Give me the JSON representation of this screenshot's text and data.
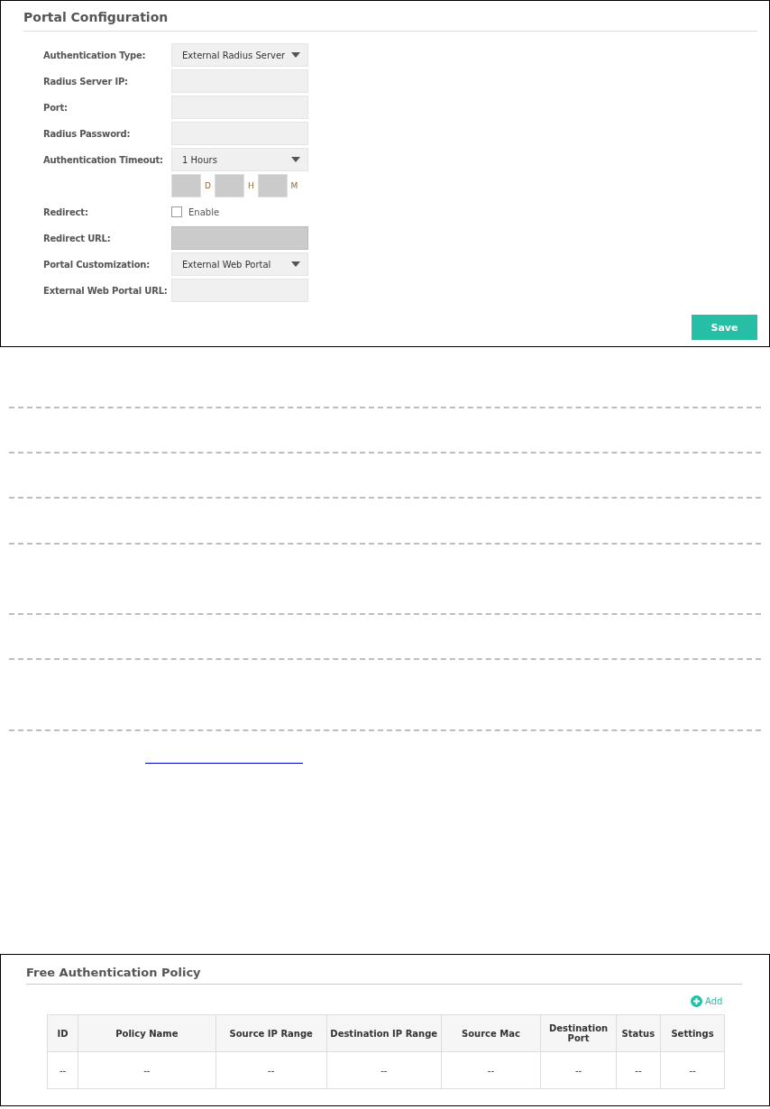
{
  "portal_configuration": {
    "title": "Portal Configuration",
    "fields": [
      {
        "kind": "select",
        "label": "Authentication Type:",
        "value": "External Radius Server"
      },
      {
        "kind": "text",
        "label": "Radius Server IP:",
        "disabled": false
      },
      {
        "kind": "text",
        "label": "Port:",
        "disabled": false
      },
      {
        "kind": "text",
        "label": "Radius Password:",
        "disabled": false
      },
      {
        "kind": "select",
        "label": "Authentication Timeout:",
        "value": "1 Hours"
      },
      {
        "kind": "timer",
        "units": [
          "D",
          "H",
          "M"
        ]
      },
      {
        "kind": "checkbox",
        "label": "Redirect:",
        "option": "Enable",
        "checked": false
      },
      {
        "kind": "text",
        "label": "Redirect URL:",
        "disabled": true
      },
      {
        "kind": "select",
        "label": "Portal Customization:",
        "value": "External Web Portal"
      },
      {
        "kind": "text",
        "label": "External Web Portal URL:",
        "disabled": false
      }
    ],
    "save_button": "Save"
  },
  "free_authentication_policy": {
    "title": "Free Authentication Policy",
    "add_button": "Add",
    "table": {
      "columns": [
        "ID",
        "Policy Name",
        "Source IP Range",
        "Destination IP Range",
        "Source Mac",
        "Destination Port",
        "Status",
        "Settings"
      ],
      "rows": [
        [
          "--",
          "--",
          "--",
          "--",
          "--",
          "--",
          "--",
          "--"
        ]
      ]
    }
  }
}
